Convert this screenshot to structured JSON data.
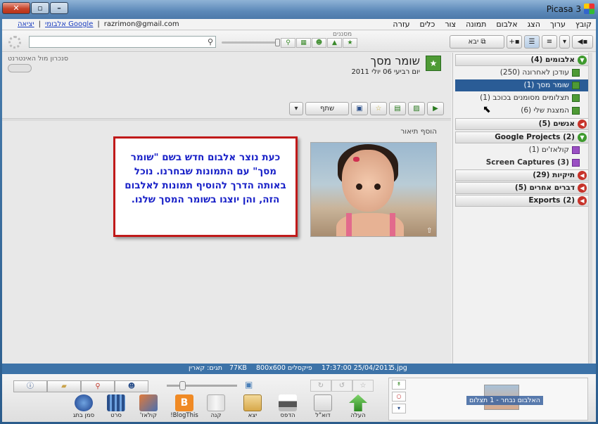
{
  "window": {
    "title": "Picasa 3",
    "btn_min": "–",
    "btn_max": "▫",
    "btn_close": "✕"
  },
  "menubar": {
    "items": [
      "קובץ",
      "ערוך",
      "הצג",
      "אלבום",
      "תמונה",
      "צור",
      "כלים",
      "עזרה"
    ],
    "email": "razrimon@gmail.com",
    "google_albums_link": "אלבומי Google",
    "separator": "|",
    "exit_link": "יציאה"
  },
  "toolbar": {
    "import_label": "יבא",
    "filters_label": "מסננים",
    "search_placeholder": ""
  },
  "sync": {
    "label": "סנכרון מול האינטרנט"
  },
  "album": {
    "title": "שומר מסך",
    "date": "יום רביעי 06 יולי 2011",
    "share_label": "שתף",
    "add_description": "הוסף תיאור"
  },
  "callout": {
    "text": "כעת נוצר אלבום חדש בשם \"שומר מסך\" עם התמונות שבחרנו. נוכל באותה הדרך להוסיף תמונות לאלבום הזה, והן יוצגו בשומר המסך שלנו."
  },
  "sidebar": {
    "groups": [
      {
        "label": "אלבומים (4)",
        "open": true
      },
      {
        "label": "אנשים (5)",
        "open": false
      },
      {
        "label": "Google Projects (2)",
        "open": true
      },
      {
        "label": "תיקיות (29)",
        "open": false
      },
      {
        "label": "דברים אחרים (5)",
        "open": false
      },
      {
        "label": "Exports (2)",
        "open": false
      }
    ],
    "albums": [
      {
        "label": "עודכן לאחרונה (250)"
      },
      {
        "label": "שומר מסך (1)"
      },
      {
        "label": "תצלומים מסומנים בכוכב (1)"
      },
      {
        "label": "המצגת שלי (6)"
      }
    ],
    "projects": [
      {
        "label": "קולאז'ים (1)"
      },
      {
        "label": "Screen Captures (3)"
      }
    ]
  },
  "status": {
    "filename": "5.jpg",
    "datetime": "17:37:00 25/04/2011",
    "dimensions": "800x600 פיקסלים",
    "size": "77KB",
    "tags": "תגים: קארין"
  },
  "tray": {
    "label": "האלבום נבחר - 1 תצלום",
    "tools": [
      "העלה",
      "דוא\"ל",
      "הדפס",
      "יצא",
      "קנה",
      "BlogThis!",
      "קולאז'",
      "סרט",
      "סמן בתג"
    ]
  },
  "colors": {
    "accent": "#2a5c96",
    "callout_border": "#c01a1a",
    "callout_text": "#1a22c8"
  }
}
